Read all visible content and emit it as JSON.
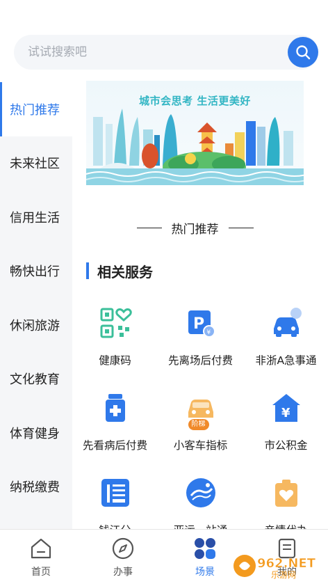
{
  "search": {
    "placeholder": "试试搜索吧"
  },
  "sidebar": {
    "items": [
      {
        "label": "热门推荐",
        "active": true
      },
      {
        "label": "未来社区"
      },
      {
        "label": "信用生活"
      },
      {
        "label": "畅快出行"
      },
      {
        "label": "休闲旅游"
      },
      {
        "label": "文化教育"
      },
      {
        "label": "体育健身"
      },
      {
        "label": "纳税缴费"
      }
    ]
  },
  "banner": {
    "title": "城市会思考 生活更美好"
  },
  "main": {
    "hot_heading": "热门推荐",
    "services_title": "相关服务",
    "services": [
      {
        "label": "健康码",
        "icon": "qr-heart-icon"
      },
      {
        "label": "先离场后付费",
        "icon": "parking-pay-icon"
      },
      {
        "label": "非浙A急事通",
        "icon": "car-urgent-icon"
      },
      {
        "label": "先看病后付费",
        "icon": "medicine-icon"
      },
      {
        "label": "小客车指标",
        "icon": "car-quota-icon",
        "badge": "阶梯"
      },
      {
        "label": "市公积金",
        "icon": "housing-fund-icon"
      },
      {
        "label": "钱江分",
        "icon": "credit-icon"
      },
      {
        "label": "亚运一站通",
        "icon": "asian-games-icon"
      },
      {
        "label": "亲情代办",
        "icon": "family-agent-icon"
      }
    ]
  },
  "bottom_nav": {
    "items": [
      {
        "label": "首页",
        "icon": "home-icon"
      },
      {
        "label": "办事",
        "icon": "compass-icon"
      },
      {
        "label": "场景",
        "icon": "scene-icon",
        "active": true
      },
      {
        "label": "我的",
        "icon": "document-icon"
      }
    ]
  },
  "watermark": {
    "text": "962.NET",
    "subtext": "乐游网"
  },
  "colors": {
    "accent": "#2f79ea",
    "teal": "#33b6c4",
    "orange": "#f08a2a"
  }
}
